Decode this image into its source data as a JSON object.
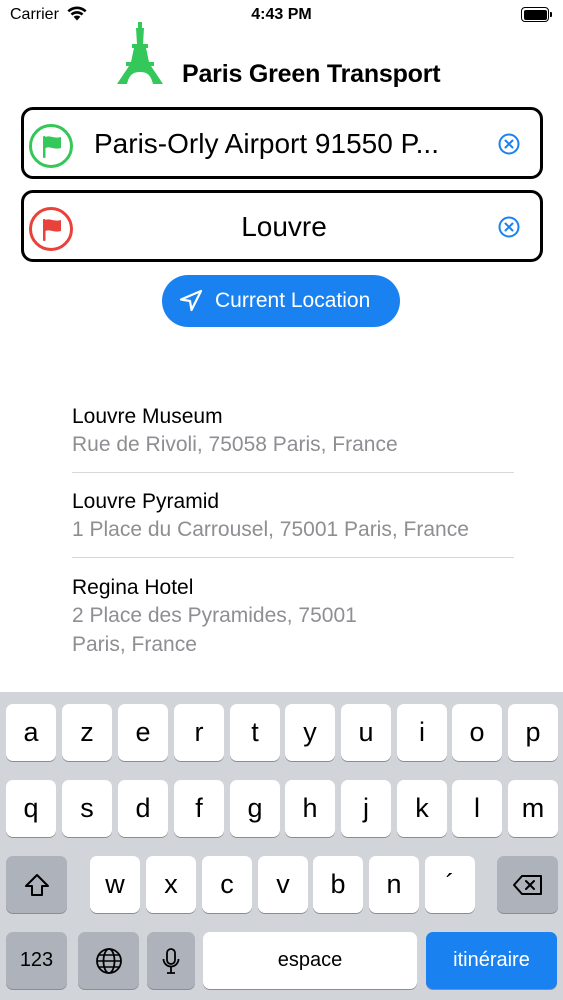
{
  "status_bar": {
    "carrier": "Carrier",
    "time": "4:43 PM"
  },
  "header": {
    "title": "Paris Green Transport",
    "logo_icon": "eiffel-tower-icon",
    "logo_color": "#34c759"
  },
  "origin": {
    "value": "Paris-Orly Airport 91550 P...",
    "flag_color": "#34c759"
  },
  "destination": {
    "value": "Louvre",
    "flag_color": "#e8423a"
  },
  "current_location": {
    "label": "Current Location",
    "color": "#1a82f0"
  },
  "results": [
    {
      "title": "Louvre Museum",
      "subtitle": "Rue de Rivoli, 75058 Paris, France"
    },
    {
      "title": "Louvre Pyramid",
      "subtitle": "1 Place du Carrousel, 75001 Paris, France"
    },
    {
      "title": "Regina Hotel",
      "subtitle_line1": "2 Place des Pyramides, 75001",
      "subtitle_line2": "Paris, France"
    }
  ],
  "keyboard": {
    "row1": [
      "a",
      "z",
      "e",
      "r",
      "t",
      "y",
      "u",
      "i",
      "o",
      "p"
    ],
    "row2": [
      "q",
      "s",
      "d",
      "f",
      "g",
      "h",
      "j",
      "k",
      "l",
      "m"
    ],
    "row3": [
      "w",
      "x",
      "c",
      "v",
      "b",
      "n",
      "´"
    ],
    "numbers_label": "123",
    "space_label": "espace",
    "return_label": "itinéraire"
  }
}
